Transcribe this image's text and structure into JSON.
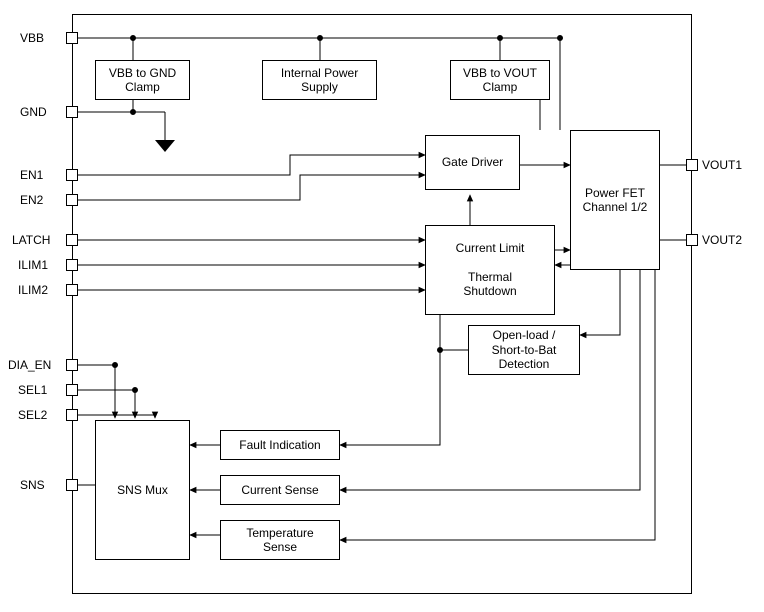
{
  "pins": {
    "vbb": "VBB",
    "gnd": "GND",
    "en1": "EN1",
    "en2": "EN2",
    "latch": "LATCH",
    "ilim1": "ILIM1",
    "ilim2": "ILIM2",
    "dia_en": "DIA_EN",
    "sel1": "SEL1",
    "sel2": "SEL2",
    "sns": "SNS",
    "vout1": "VOUT1",
    "vout2": "VOUT2"
  },
  "blocks": {
    "vbb_gnd_clamp": "VBB to GND\nClamp",
    "internal_ps": "Internal Power\nSupply",
    "vbb_vout_clamp": "VBB to VOUT\nClamp",
    "gate_driver": "Gate Driver",
    "power_fet": "Power FET\nChannel 1/2",
    "curr_limit": "Current Limit\n\nThermal\nShutdown",
    "open_load": "Open-load /\nShort-to-Bat\nDetection",
    "fault_ind": "Fault Indication",
    "curr_sense": "Current Sense",
    "temp_sense": "Temperature\nSense",
    "sns_mux": "SNS Mux"
  }
}
